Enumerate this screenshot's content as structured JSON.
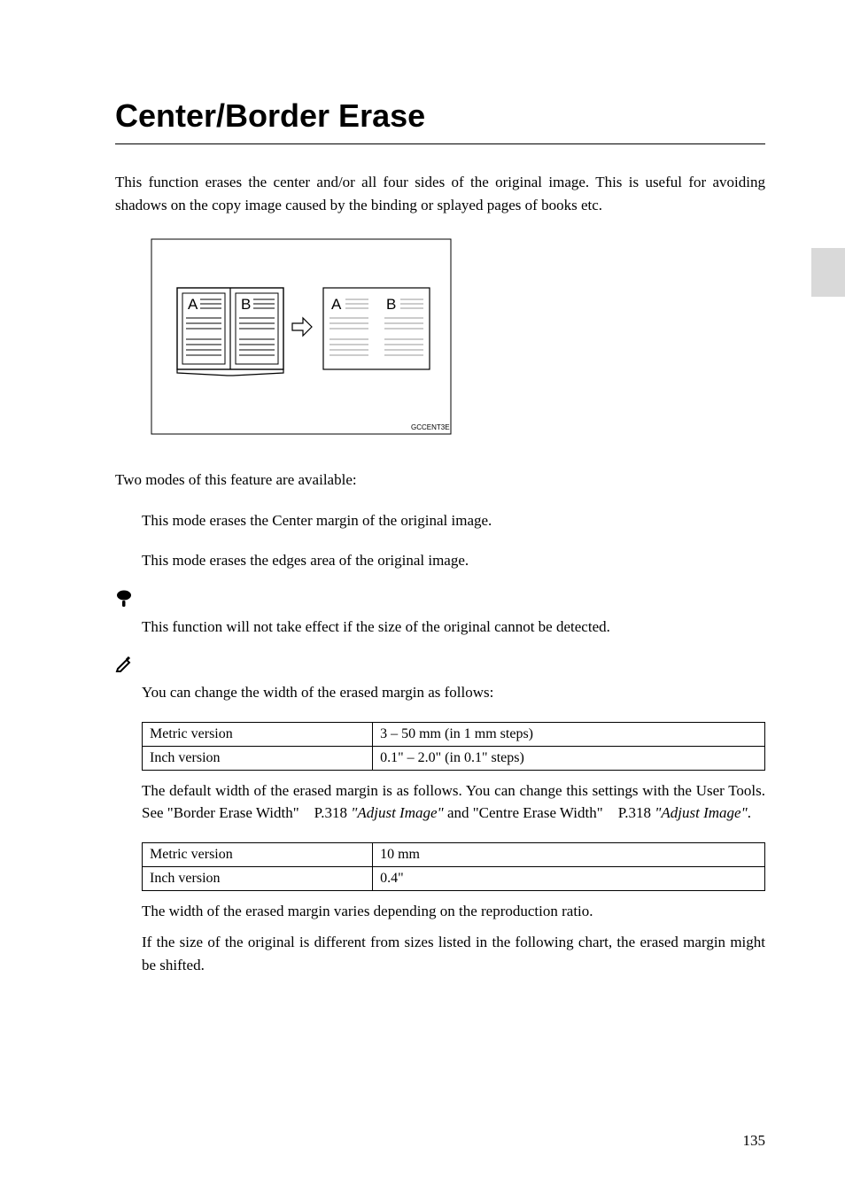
{
  "heading": "Center/Border Erase",
  "intro": "This function erases the center and/or all four sides of the original image. This is useful for avoiding shadows on the copy image caused by the binding or splayed pages of books etc.",
  "modes_intro": "Two modes of this feature are available:",
  "mode1": "This mode erases the Center margin of the original image.",
  "mode2": "This mode erases the edges area of the original image.",
  "limitation": "This function will not take effect if the size of the original cannot be detected.",
  "note_intro": "You can change the width of the erased margin as follows:",
  "table1": {
    "r1c1": "Metric version",
    "r1c2": "3 – 50 mm (in 1 mm steps)",
    "r2c1": "Inch version",
    "r2c2": "0.1\" – 2.0\" (in 0.1\" steps)"
  },
  "default_text_a": "The default width of the erased margin is as follows. You can change this settings with the User Tools. See \"Border Erase Width\"",
  "default_text_b": "P.318",
  "default_text_c": "\"Adjust Image\"",
  "default_text_d": "and \"Centre Erase Width\"",
  "default_text_e": "P.318",
  "default_text_f": "\"Adjust Image\"",
  "table2": {
    "r1c1": "Metric version",
    "r1c2": "10 mm",
    "r2c1": "Inch version",
    "r2c2": "0.4\""
  },
  "width_note": "The width of the erased margin varies depending on the reproduction ratio.",
  "size_note": "If the size of the original is different from sizes listed in the following chart, the erased margin might be shifted.",
  "page_number": "135",
  "diagram_label": "GCCENT3E"
}
